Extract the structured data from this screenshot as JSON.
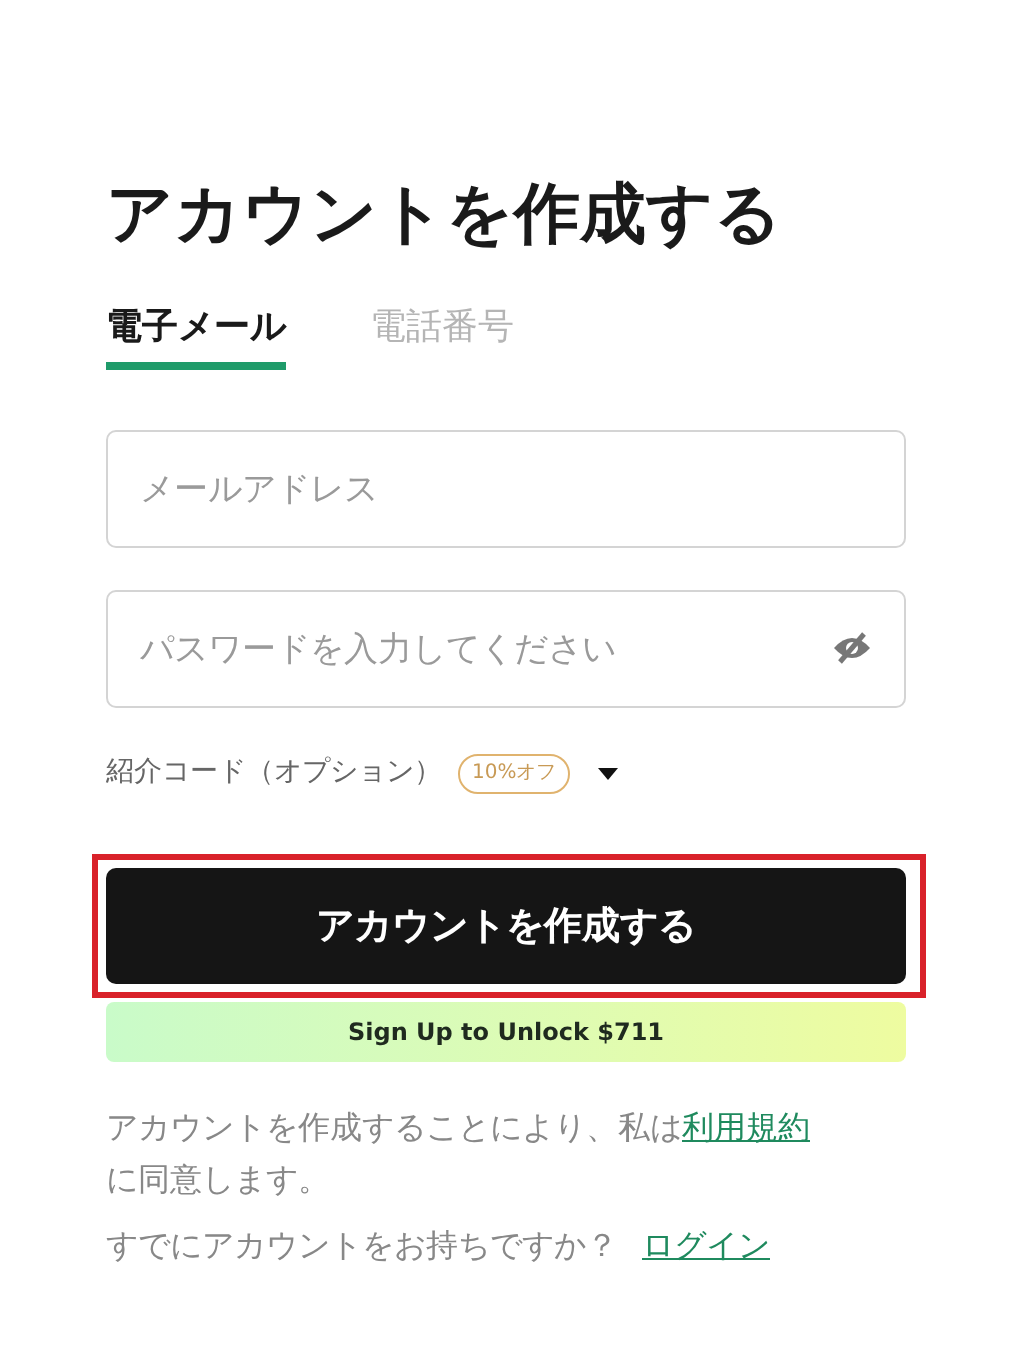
{
  "title": "アカウントを作成する",
  "tabs": [
    {
      "label": "電子メール",
      "selected": true
    },
    {
      "label": "電話番号",
      "selected": false
    }
  ],
  "email_field": {
    "placeholder": "メールアドレス"
  },
  "password_field": {
    "placeholder": "パスワードを入力してください",
    "visible": false
  },
  "referral": {
    "label": "紹介コード（オプション）",
    "badge": "10%オフ",
    "expanded": false
  },
  "submit_button": {
    "label": "アカウントを作成する",
    "highlighted": true
  },
  "promo_banner": "Sign Up to Unlock $711",
  "terms": {
    "text": "アカウントを作成することにより、私は",
    "link": "利用規約",
    "suffix": "に同意します。"
  },
  "login_prompt": {
    "text": "すでにアカウントをお持ちですか？",
    "link": "ログイン"
  }
}
